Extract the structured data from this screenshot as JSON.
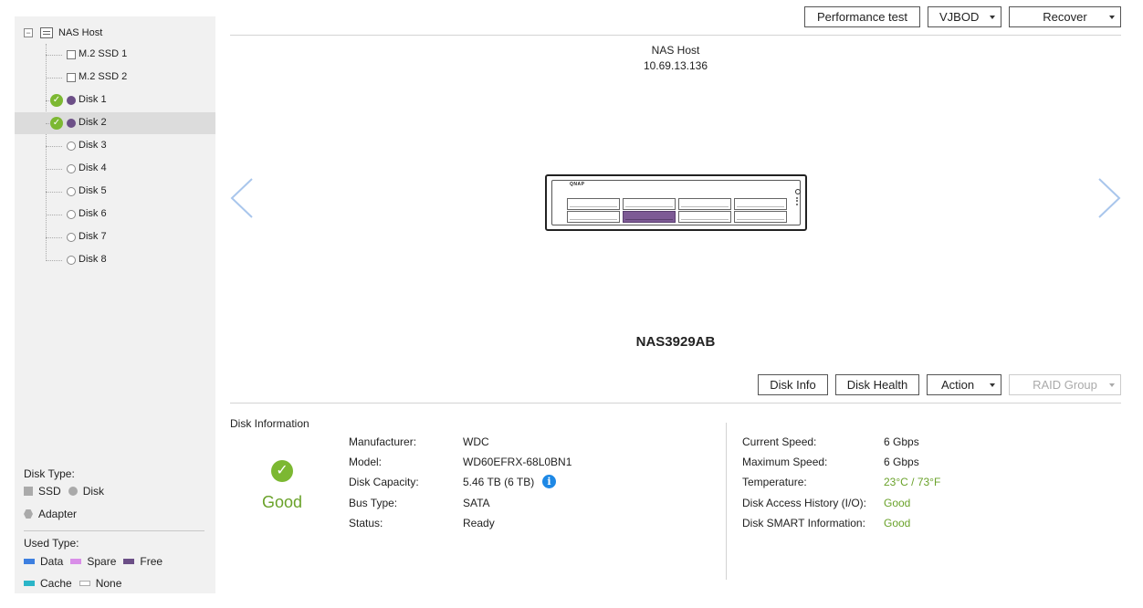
{
  "toolbar": {
    "performance_test": "Performance test",
    "vjbod": "VJBOD",
    "recover": "Recover"
  },
  "tree": {
    "root": "NAS Host",
    "items": [
      {
        "label": "M.2 SSD 1",
        "icon": "square-icon",
        "check": false,
        "filled": false,
        "selected": false
      },
      {
        "label": "M.2 SSD 2",
        "icon": "square-icon",
        "check": false,
        "filled": false,
        "selected": false
      },
      {
        "label": "Disk 1",
        "icon": "circle-icon",
        "check": true,
        "filled": true,
        "selected": false
      },
      {
        "label": "Disk 2",
        "icon": "circle-icon",
        "check": true,
        "filled": true,
        "selected": true
      },
      {
        "label": "Disk 3",
        "icon": "circle-icon",
        "check": false,
        "filled": false,
        "selected": false
      },
      {
        "label": "Disk 4",
        "icon": "circle-icon",
        "check": false,
        "filled": false,
        "selected": false
      },
      {
        "label": "Disk 5",
        "icon": "circle-icon",
        "check": false,
        "filled": false,
        "selected": false
      },
      {
        "label": "Disk 6",
        "icon": "circle-icon",
        "check": false,
        "filled": false,
        "selected": false
      },
      {
        "label": "Disk 7",
        "icon": "circle-icon",
        "check": false,
        "filled": false,
        "selected": false
      },
      {
        "label": "Disk 8",
        "icon": "circle-icon",
        "check": false,
        "filled": false,
        "selected": false
      }
    ]
  },
  "legend": {
    "disk_type_title": "Disk Type:",
    "ssd": "SSD",
    "disk": "Disk",
    "adapter": "Adapter",
    "used_type_title": "Used Type:",
    "data": "Data",
    "spare": "Spare",
    "free": "Free",
    "cache": "Cache",
    "none": "None",
    "colors": {
      "data": "#3d7fe0",
      "spare": "#d98ee8",
      "free": "#6c4f87",
      "cache": "#2bb5c8",
      "none": "#ffffff"
    }
  },
  "host": {
    "name": "NAS Host",
    "ip": "10.69.13.136",
    "device_name": "NAS3929AB",
    "brand": "QNAP",
    "active_bay": 6
  },
  "actions": {
    "disk_info": "Disk Info",
    "disk_health": "Disk Health",
    "action": "Action",
    "raid_group": "RAID Group"
  },
  "disk_info": {
    "title": "Disk Information",
    "status_text": "Good",
    "left": [
      {
        "label": "Manufacturer:",
        "value": "WDC"
      },
      {
        "label": "Model:",
        "value": "WD60EFRX-68L0BN1"
      },
      {
        "label": "Disk Capacity:",
        "value": "5.46 TB (6 TB)"
      },
      {
        "label": "Bus Type:",
        "value": "SATA"
      },
      {
        "label": "Status:",
        "value": "Ready"
      }
    ],
    "right": [
      {
        "label": "Current Speed:",
        "value": "6 Gbps"
      },
      {
        "label": "Maximum Speed:",
        "value": "6 Gbps"
      },
      {
        "label": "Temperature:",
        "value": "23°C / 73°F"
      },
      {
        "label": "Disk Access History (I/O):",
        "value": "Good"
      },
      {
        "label": "Disk SMART Information:",
        "value": "Good"
      }
    ]
  },
  "colors": {
    "good": "#6aa22a",
    "accent_purple": "#6c4f87",
    "info_blue": "#1e88e5"
  }
}
